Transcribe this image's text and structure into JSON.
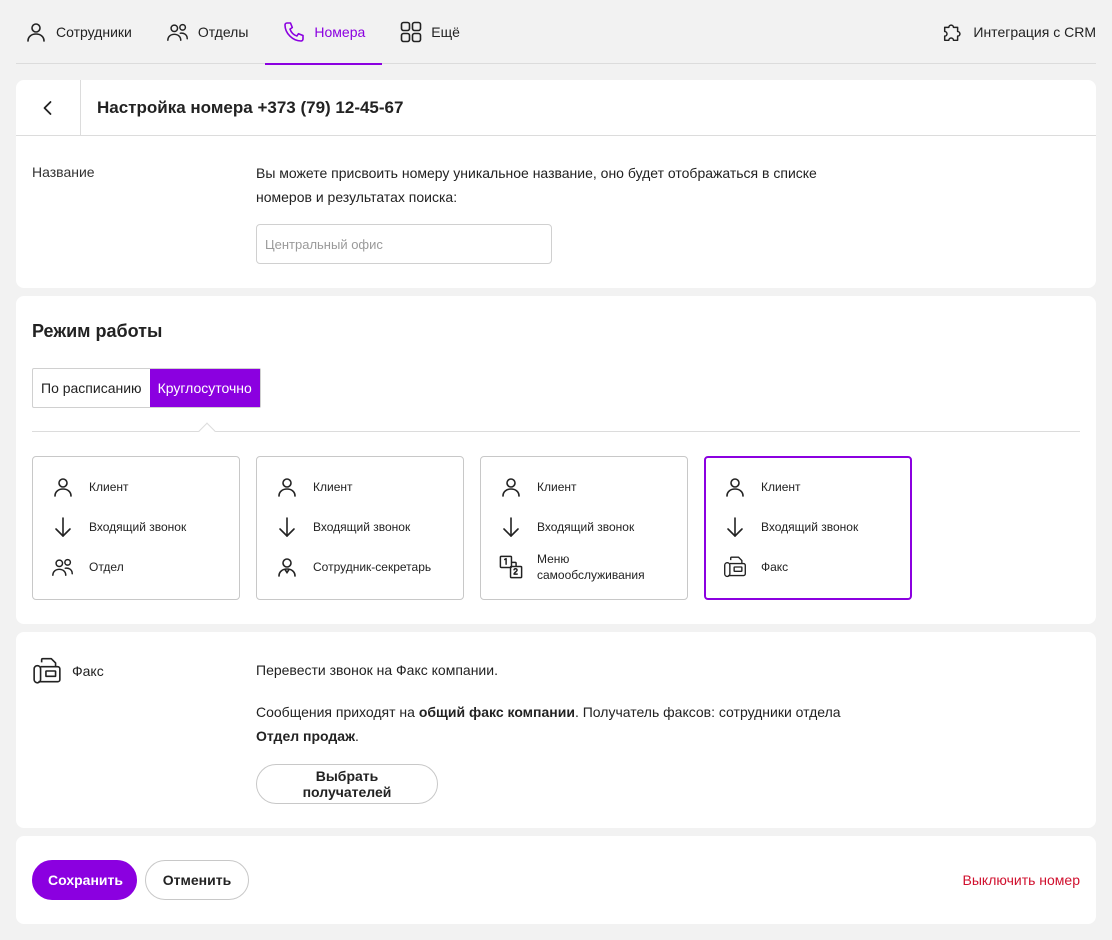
{
  "nav": {
    "items": [
      {
        "label": "Сотрудники",
        "icon": "person-icon"
      },
      {
        "label": "Отделы",
        "icon": "group-icon"
      },
      {
        "label": "Номера",
        "icon": "phone-icon",
        "active": true
      },
      {
        "label": "Ещё",
        "icon": "grid-icon"
      }
    ],
    "crm": {
      "label": "Интеграция с CRM",
      "icon": "puzzle-icon"
    }
  },
  "header": {
    "title": "Настройка номера +373 (79) 12-45-67"
  },
  "name_field": {
    "label": "Название",
    "description": "Вы можете присвоить номеру уникальное название, оно будет отображаться в списке номеров и результатах поиска:",
    "placeholder": "Центральный офис",
    "value": ""
  },
  "mode": {
    "title": "Режим работы",
    "tabs": [
      {
        "label": "По расписанию",
        "active": false
      },
      {
        "label": "Круглосуточно",
        "active": true
      }
    ],
    "scenarios": [
      {
        "client": "Клиент",
        "call": "Входящий звонок",
        "target": "Отдел",
        "target_icon": "group-icon",
        "selected": false
      },
      {
        "client": "Клиент",
        "call": "Входящий звонок",
        "target": "Сотрудник-секретарь",
        "target_icon": "secretary-icon",
        "selected": false
      },
      {
        "client": "Клиент",
        "call": "Входящий звонок",
        "target": "Меню самообслуживания",
        "target_icon": "ivr-menu-icon",
        "selected": false
      },
      {
        "client": "Клиент",
        "call": "Входящий звонок",
        "target": "Факс",
        "target_icon": "fax-icon",
        "selected": true
      }
    ]
  },
  "fax": {
    "label": "Факс",
    "text1": "Перевести звонок на Факс компании.",
    "text2_part1": "Сообщения приходят на ",
    "text2_bold1": "общий факс компании",
    "text2_part2": ". Получатель факсов: сотрудники отдела ",
    "text2_bold2": "Отдел продаж",
    "text2_part3": ".",
    "button": "Выбрать получателей"
  },
  "actions": {
    "save": "Сохранить",
    "cancel": "Отменить",
    "disable": "Выключить номер"
  },
  "colors": {
    "accent": "#8b00e0",
    "danger": "#d0102e"
  }
}
